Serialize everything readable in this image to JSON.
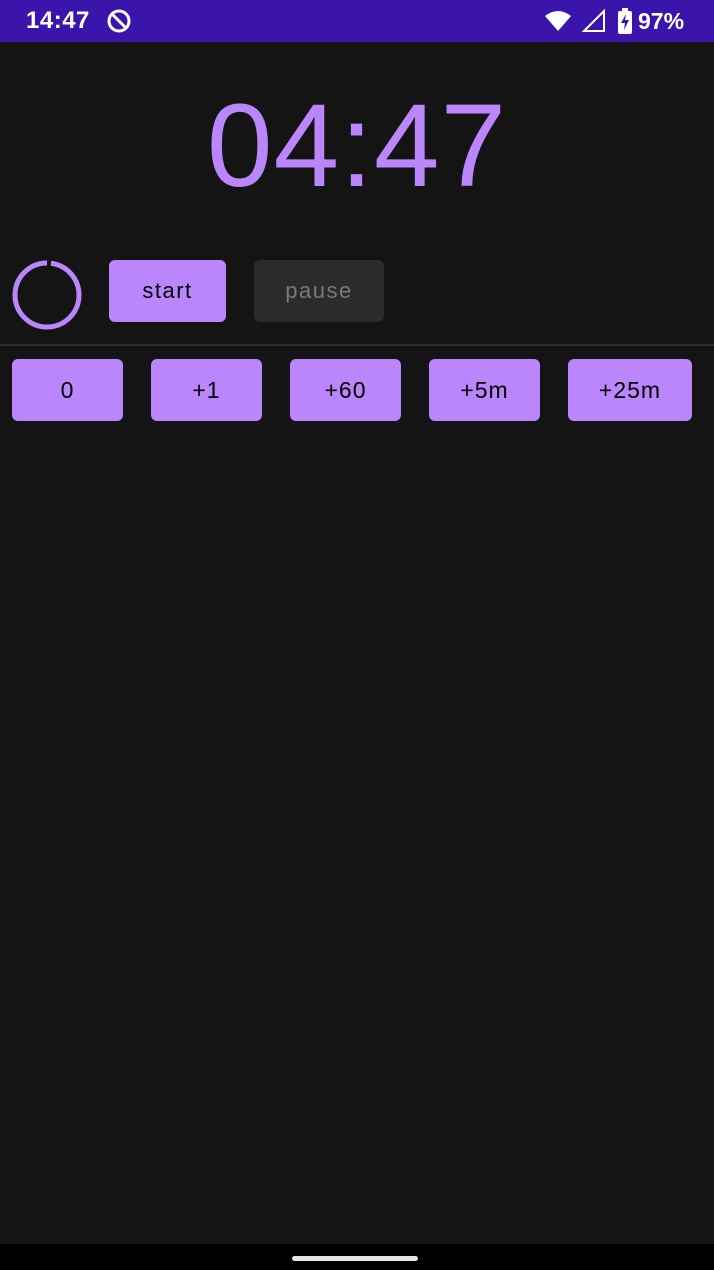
{
  "status_bar": {
    "time": "14:47",
    "battery_percent": "97%",
    "app_icon": "do-not-disturb-icon",
    "wifi_icon": "wifi-icon",
    "signal_icon": "cell-signal-icon",
    "battery_icon": "battery-charging-icon",
    "color": "#3A14AB"
  },
  "timer": {
    "display": "04:47",
    "color": "#BB86FC"
  },
  "controls": {
    "start_label": "start",
    "pause_label": "pause",
    "pause_enabled": false,
    "progress_icon": "progress-ring-icon",
    "progress_fraction": 0.98
  },
  "add_buttons": [
    {
      "label": "0"
    },
    {
      "label": "+1"
    },
    {
      "label": "+60"
    },
    {
      "label": "+5m"
    },
    {
      "label": "+25m"
    }
  ],
  "theme": {
    "accent": "#BB86FC",
    "background": "#141414",
    "disabled_bg": "#2B2B2B",
    "disabled_text": "#7A7A7A"
  }
}
